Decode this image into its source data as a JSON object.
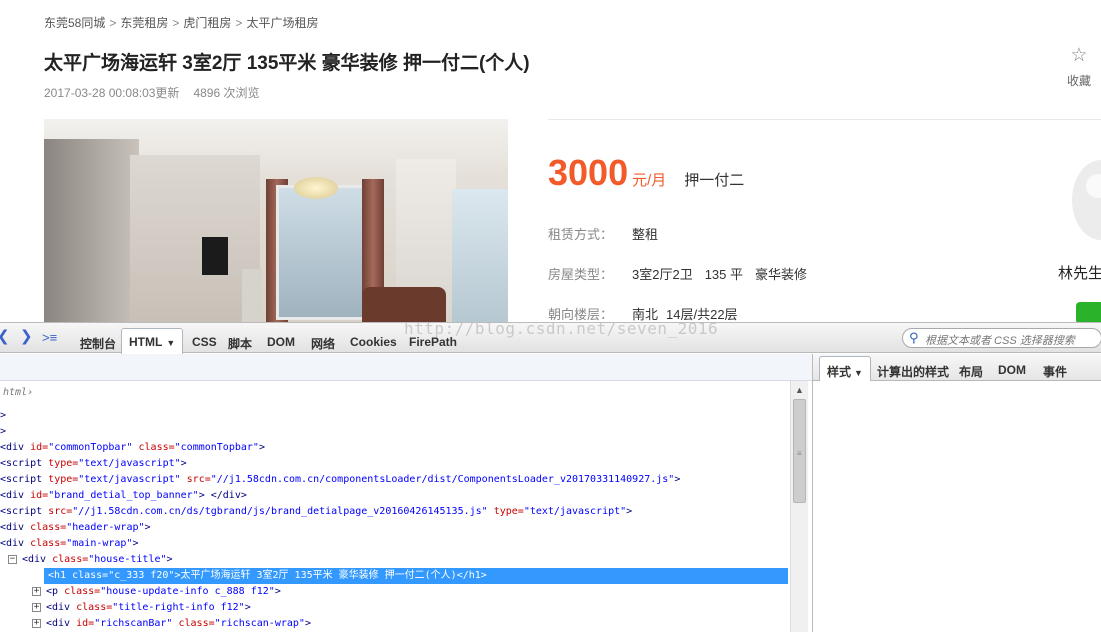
{
  "page": {
    "breadcrumb": [
      "东莞58同城",
      "东莞租房",
      "虎门租房",
      "太平广场租房"
    ],
    "breadcrumb_sep": ">",
    "title": "太平广场海运轩 3室2厅 135平米 豪华装修 押一付二(个人)",
    "update_time": "2017-03-28 00:08:03更新",
    "views": "4896 次浏览",
    "favorite_label": "收藏",
    "price": {
      "amount": "3000",
      "unit": "元/月",
      "payment": "押一付二"
    },
    "details": [
      {
        "key": "租赁方式：",
        "values": [
          "整租"
        ]
      },
      {
        "key": "房屋类型：",
        "values": [
          "3室2厅2卫",
          "135 平",
          "豪华装修"
        ]
      },
      {
        "key": "朝向楼层：",
        "values": [
          "南北",
          "14层/共22层"
        ]
      }
    ],
    "poster_name": "林先生"
  },
  "devtools": {
    "main_tabs": [
      "控制台",
      "HTML",
      "CSS",
      "脚本",
      "DOM",
      "网络",
      "Cookies",
      "FirePath"
    ],
    "active_main_tab": "HTML",
    "search_placeholder": "根据文本或者 CSS 选择器搜索",
    "watermark": "http://blog.csdn.net/seven_2016",
    "side_tabs": [
      "样式",
      "计算出的样式",
      "布局",
      "DOM",
      "事件"
    ],
    "active_side_tab": "样式",
    "html_crumb": "html",
    "tree": [
      {
        "text": ">",
        "indent": 0
      },
      {
        "text": ">",
        "indent": 0
      },
      {
        "tag": "div",
        "attrs": [
          [
            "id",
            "commonTopbar"
          ],
          [
            "class",
            "commonTopbar"
          ]
        ],
        "close": ">",
        "indent": 0
      },
      {
        "tag": "script",
        "attrs": [
          [
            "type",
            "text/javascript"
          ]
        ],
        "close": ">",
        "indent": 0
      },
      {
        "tag": "script",
        "attrs": [
          [
            "type",
            "text/javascript"
          ],
          [
            "src",
            "//j1.58cdn.com.cn/componentsLoader/dist/ComponentsLoader_v20170331140927.js"
          ]
        ],
        "close": ">",
        "indent": 0
      },
      {
        "tag": "div",
        "attrs": [
          [
            "id",
            "brand_detial_top_banner"
          ]
        ],
        "close": "> </div>",
        "indent": 0
      },
      {
        "tag": "script",
        "attrs": [
          [
            "src",
            "//j1.58cdn.com.cn/ds/tgbrand/js/brand_detialpage_v20160426145135.js"
          ],
          [
            "type",
            "text/javascript"
          ]
        ],
        "close": ">",
        "indent": 0
      },
      {
        "tag": "div",
        "attrs": [
          [
            "class",
            "header-wrap"
          ]
        ],
        "close": ">",
        "indent": 0
      },
      {
        "tag": "div",
        "attrs": [
          [
            "class",
            "main-wrap"
          ]
        ],
        "close": ">",
        "indent": 0
      },
      {
        "tag": "div",
        "attrs": [
          [
            "class",
            "house-title"
          ]
        ],
        "close": ">",
        "indent": 1,
        "toggle": "−"
      },
      {
        "tag": "h1",
        "attrs": [
          [
            "class",
            "c_333 f20"
          ]
        ],
        "close": ">太平广场海运轩 3室2厅 135平米 豪华装修 押一付二(个人)</h1>",
        "indent": 2,
        "selected": true
      },
      {
        "tag": "p",
        "attrs": [
          [
            "class",
            "house-update-info c_888 f12"
          ]
        ],
        "close": ">",
        "indent": 2,
        "toggle": "+"
      },
      {
        "tag": "div",
        "attrs": [
          [
            "class",
            "title-right-info f12"
          ]
        ],
        "close": ">",
        "indent": 2,
        "toggle": "+"
      },
      {
        "tag": "div",
        "attrs": [
          [
            "id",
            "richscanBar"
          ],
          [
            "class",
            "richscan-wrap"
          ]
        ],
        "close": ">",
        "indent": 2,
        "toggle": "+"
      }
    ]
  }
}
